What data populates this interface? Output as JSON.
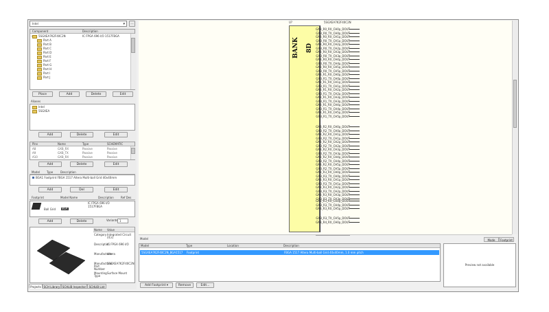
{
  "library_selector": {
    "value": "Intel"
  },
  "components": {
    "header": [
      "Component",
      "Description"
    ],
    "root": {
      "name": "5SGXEA7K2F40C2N",
      "description": "IC FPGA 696 I/O 1517FBGA"
    },
    "units": [
      "Part A",
      "Part B",
      "Part C",
      "Part D",
      "Part E",
      "Part F",
      "Part G",
      "Part H",
      "Part I",
      "Part J"
    ],
    "buttons": [
      "Place",
      "Add",
      "Delete",
      "Edit"
    ]
  },
  "aliases": {
    "title": "Aliases",
    "items": [
      "Intel",
      "5SGXEA"
    ],
    "buttons": [
      "Add",
      "Delete",
      "Edit"
    ]
  },
  "pins": {
    "header": [
      "Pins",
      "Name",
      "Type",
      "SCHEMATIC"
    ],
    "rows": [
      [
        "A8",
        "GXB_RX",
        "Passive",
        "Passive"
      ],
      [
        "A9",
        "GXB_TX",
        "Passive",
        "Passive"
      ],
      [
        "A10",
        "GXB_RX",
        "Passive",
        "Passive"
      ]
    ],
    "buttons": [
      "Add",
      "Delete",
      "Edit"
    ]
  },
  "models": {
    "header": [
      "Model",
      "Type",
      "Description"
    ],
    "row": "BGA1 Footprint FBGA 1517 Altera Multi-ball Grid 40x40mm",
    "buttons": [
      "Add",
      "Del",
      "Edit"
    ]
  },
  "footprint": {
    "header": [
      "Footprint",
      "Model Name",
      "Description",
      "Ref Des"
    ],
    "name": "Ball Grid",
    "tag": "BGA",
    "desc_line1": "IC FPGA 696 I/O",
    "desc_line2": "1517FBGA",
    "variants_label": "Variants:",
    "variants_value": "1",
    "buttons": [
      "Add",
      "Delete"
    ]
  },
  "parameters": {
    "header": [
      "Name",
      "Value"
    ],
    "rows": [
      [
        "Category",
        "Integrated Circuit (ICs)"
      ],
      [
        "Description",
        "IC FPGA 696 I/O"
      ],
      [
        "Manufacturer",
        "Altera"
      ],
      [
        "Manufacturer Part Number",
        "5SGXEA7K2F40C2N"
      ],
      [
        "Mounting Type",
        "Surface Mount"
      ]
    ]
  },
  "bottom_tabs": [
    "Projects",
    "SCH Library",
    "SCHLIB Inspector",
    "SCHLIB List"
  ],
  "schematic": {
    "designator": "U?",
    "comment": "5SGXEA7K2F40C2N",
    "bank_label": "BANK 8D",
    "pins_group1": [
      "GXB_R0_RX_CH0p_DOUT",
      "GXB_R0_TX_CH0p_DOUT",
      "GXB_R0_RX_CH1p_DOUT",
      "GXB_R0_TX_CH1p_DOUT",
      "GXB_R0_RX_CH2p_DOUT",
      "GXB_R0_TX_CH2p_DOUT",
      "GXB_R0_RX_CH3p_DOUT",
      "GXB_R0_TX_CH3p_DOUT",
      "GXB_R0_RX_CH4p_DOUT",
      "GXB_R0_TX_CH4p_DOUT",
      "GXB_R0_RX_CH5p_DOUT",
      "GXB_R0_TX_CH5p_DOUT",
      "GXB_R1_RX_CH0p_DOUT",
      "GXB_R1_TX_CH0p_DOUT",
      "GXB_R1_RX_CH1p_DOUT",
      "GXB_R1_TX_CH1p_DOUT",
      "GXB_R1_RX_CH2p_DOUT",
      "GXB_R1_TX_CH2p_DOUT",
      "GXB_R1_RX_CH3p_DOUT",
      "GXB_R1_TX_CH3p_DOUT",
      "GXB_R1_RX_CH4p_DOUT",
      "GXB_R1_TX_CH4p_DOUT",
      "GXB_R1_RX_CH5p_DOUT",
      "GXB_R1_TX_CH5p_DOUT"
    ],
    "pins_group2": [
      "GXB_R2_RX_CH0p_DOUT",
      "GXB_R2_TX_CH0p_DOUT",
      "GXB_R2_RX_CH1p_DOUT",
      "GXB_R2_TX_CH1p_DOUT",
      "GXB_R2_RX_CH2p_DOUT",
      "GXB_R2_TX_CH2p_DOUT",
      "GXB_R2_RX_CH3p_DOUT",
      "GXB_R2_TX_CH3p_DOUT",
      "GXB_R2_RX_CH4p_DOUT",
      "GXB_R2_TX_CH4p_DOUT",
      "GXB_R2_RX_CH5p_DOUT",
      "GXB_R2_TX_CH5p_DOUT",
      "GXB_R3_RX_CH0p_DOUT",
      "GXB_R3_TX_CH0p_DOUT",
      "GXB_R3_RX_CH1p_DOUT",
      "GXB_R3_TX_CH1p_DOUT",
      "GXB_R3_RX_CH2p_DOUT",
      "GXB_R3_TX_CH2p_DOUT",
      "GXB_R3_RX_CH3p_DOUT",
      "GXB_R3_TX_CH3p_DOUT"
    ],
    "pins_group3": [
      "GXB_R3_RX_CH4p_DOUT",
      "GXB_R3_TX_CH4p_DOUT",
      "GXB_R3_RX_CH5p_DOUT"
    ],
    "pins_group4": [
      "GXB_R3_TX_CH5p_DOUT",
      "GXB_R4_RX_CH0p_DOUT"
    ]
  },
  "model_panel": {
    "title": "Model",
    "header": [
      "Model",
      "Type",
      "Location",
      "Description"
    ],
    "row": [
      "5SGXEA7K2F40C2N_BGA1517",
      "Footprint",
      "",
      "FBGA 1517 Altera Multi-ball Grid 40x40mm, 1.0 mm pitch"
    ],
    "preview_text": "Preview not available",
    "tabs": [
      "Mode",
      "Footprint"
    ],
    "buttons": [
      "Add Footprint",
      "Remove",
      "Edit..."
    ]
  }
}
